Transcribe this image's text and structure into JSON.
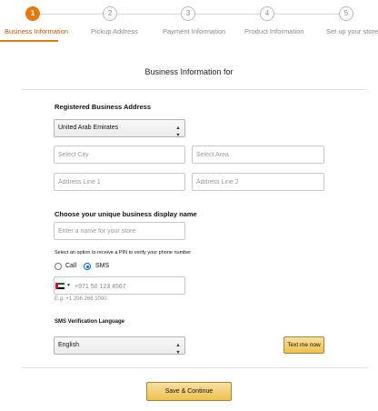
{
  "stepper": {
    "steps": [
      {
        "number": "1",
        "label": "Business Information",
        "active": true
      },
      {
        "number": "2",
        "label": "Pickup Address",
        "active": false
      },
      {
        "number": "3",
        "label": "Payment Information",
        "active": false
      },
      {
        "number": "4",
        "label": "Product Information",
        "active": false
      },
      {
        "number": "5",
        "label": "Set up your store",
        "active": false
      }
    ],
    "colors": {
      "active": "#e47911",
      "active_label": "#c45500",
      "inactive": "#8a8a8a"
    }
  },
  "page_title": "Business Information for",
  "registered_address": {
    "label": "Registered Business Address",
    "country": {
      "value": "United Arab Emirates",
      "icon": "chevron-updown-icon"
    },
    "city": {
      "placeholder": "Select City"
    },
    "area": {
      "placeholder": "Select Area"
    },
    "address_line_1": {
      "placeholder": "Address Line 1"
    },
    "address_line_2": {
      "placeholder": "Address Line 2"
    }
  },
  "display_name": {
    "label": "Choose your unique business display name",
    "placeholder": "Enter a name for your store"
  },
  "pin": {
    "label": "Select an option to receive a PIN to verify your phone number",
    "options": [
      {
        "label": "Call",
        "checked": false
      },
      {
        "label": "SMS",
        "checked": true
      }
    ]
  },
  "phone": {
    "country_flag": "uae-flag-icon",
    "placeholder": "+971 50 123 4567",
    "hint": "E.g. +1 206 266 1000"
  },
  "sms_language": {
    "label": "SMS Verification Language",
    "value": "English",
    "text_me_button": "Text me now"
  },
  "actions": {
    "save_continue": "Save & Continue",
    "button_color": "#f0c14b"
  }
}
